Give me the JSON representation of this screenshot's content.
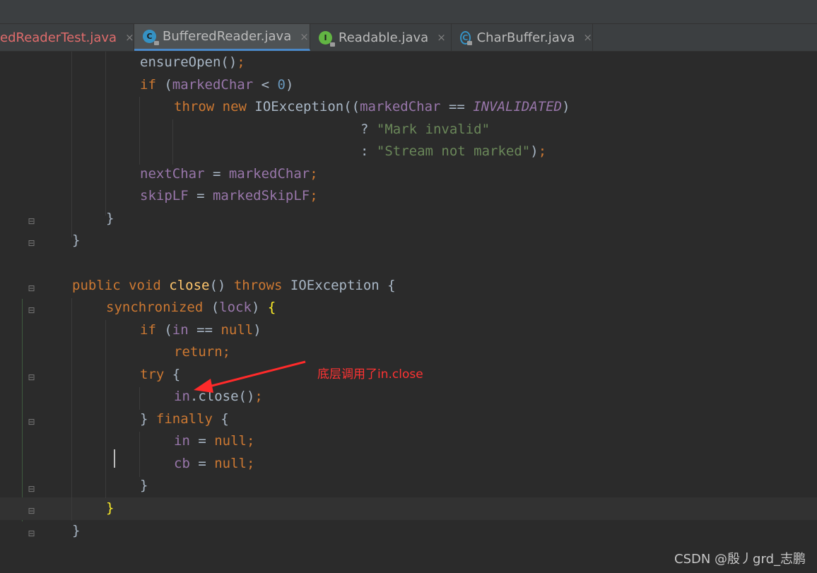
{
  "tabs": [
    {
      "label": "edReaderTest.java",
      "icon": "java-class-icon",
      "active": false,
      "modified": true
    },
    {
      "label": "BufferedReader.java",
      "icon": "class-icon",
      "icon_letter": "C",
      "active": true
    },
    {
      "label": "Readable.java",
      "icon": "interface-icon",
      "icon_letter": "I",
      "active": false
    },
    {
      "label": "CharBuffer.java",
      "icon": "abstract-class-icon",
      "icon_letter": "C",
      "active": false
    }
  ],
  "tab_close_glyph": "×",
  "code_lines": [
    [
      {
        "t": "ensureOpen",
        "c": "pl"
      },
      {
        "t": "()",
        "c": "pl"
      },
      {
        "t": ";",
        "c": "kw"
      }
    ],
    [
      {
        "t": "if",
        "c": "kw"
      },
      {
        "t": " (",
        "c": "pl"
      },
      {
        "t": "markedChar",
        "c": "fd"
      },
      {
        "t": " < ",
        "c": "pl"
      },
      {
        "t": "0",
        "c": "nm"
      },
      {
        "t": ")",
        "c": "pl"
      }
    ],
    [
      {
        "t": "throw new ",
        "c": "kw"
      },
      {
        "t": "IOException((",
        "c": "pl"
      },
      {
        "t": "markedChar",
        "c": "fd"
      },
      {
        "t": " == ",
        "c": "pl"
      },
      {
        "t": "INVALIDATED",
        "c": "fdi"
      },
      {
        "t": ")",
        "c": "pl"
      }
    ],
    [
      {
        "t": "? ",
        "c": "pl"
      },
      {
        "t": "\"Mark invalid\"",
        "c": "st"
      }
    ],
    [
      {
        "t": ": ",
        "c": "pl"
      },
      {
        "t": "\"Stream not marked\"",
        "c": "st"
      },
      {
        "t": ")",
        "c": "pl"
      },
      {
        "t": ";",
        "c": "kw"
      }
    ],
    [
      {
        "t": "nextChar",
        "c": "fd"
      },
      {
        "t": " = ",
        "c": "pl"
      },
      {
        "t": "markedChar",
        "c": "fd"
      },
      {
        "t": ";",
        "c": "kw"
      }
    ],
    [
      {
        "t": "skipLF",
        "c": "fd"
      },
      {
        "t": " = ",
        "c": "pl"
      },
      {
        "t": "markedSkipLF",
        "c": "fd"
      },
      {
        "t": ";",
        "c": "kw"
      }
    ],
    [
      {
        "t": "}",
        "c": "pl"
      }
    ],
    [
      {
        "t": "}",
        "c": "pl"
      }
    ],
    [],
    [
      {
        "t": "public void ",
        "c": "kw"
      },
      {
        "t": "close",
        "c": "fn"
      },
      {
        "t": "() ",
        "c": "pl"
      },
      {
        "t": "throws ",
        "c": "kw"
      },
      {
        "t": "IOException {",
        "c": "pl"
      }
    ],
    [
      {
        "t": "synchronized ",
        "c": "kw"
      },
      {
        "t": "(",
        "c": "pl"
      },
      {
        "t": "lock",
        "c": "fd"
      },
      {
        "t": ") ",
        "c": "pl"
      },
      {
        "t": "{",
        "c": "br"
      }
    ],
    [
      {
        "t": "if",
        "c": "kw"
      },
      {
        "t": " (",
        "c": "pl"
      },
      {
        "t": "in",
        "c": "fd"
      },
      {
        "t": " == ",
        "c": "pl"
      },
      {
        "t": "null",
        "c": "kw"
      },
      {
        "t": ")",
        "c": "pl"
      }
    ],
    [
      {
        "t": "return",
        "c": "kw"
      },
      {
        "t": ";",
        "c": "kw"
      }
    ],
    [
      {
        "t": "try ",
        "c": "kw"
      },
      {
        "t": "{",
        "c": "pl"
      }
    ],
    [
      {
        "t": "in",
        "c": "fd"
      },
      {
        "t": ".close()",
        "c": "pl"
      },
      {
        "t": ";",
        "c": "kw"
      }
    ],
    [
      {
        "t": "} ",
        "c": "pl"
      },
      {
        "t": "finally ",
        "c": "kw"
      },
      {
        "t": "{",
        "c": "pl"
      }
    ],
    [
      {
        "t": "in",
        "c": "fd"
      },
      {
        "t": " = ",
        "c": "pl"
      },
      {
        "t": "null",
        "c": "kw"
      },
      {
        "t": ";",
        "c": "kw"
      }
    ],
    [
      {
        "t": "cb",
        "c": "fd"
      },
      {
        "t": " = ",
        "c": "pl"
      },
      {
        "t": "null",
        "c": "kw"
      },
      {
        "t": ";",
        "c": "kw"
      }
    ],
    [
      {
        "t": "}",
        "c": "pl"
      }
    ],
    [
      {
        "t": "}",
        "c": "br"
      }
    ],
    [
      {
        "t": "}",
        "c": "pl"
      }
    ]
  ],
  "annotation": "底层调用了in.close",
  "watermark": "CSDN @殷丿grd_志鹏",
  "colors": {
    "background": "#2b2b2b",
    "keyword": "#cc7832",
    "field": "#9876aa",
    "string": "#6a8759",
    "number": "#6897bb",
    "method_decl": "#ffc66d",
    "annotation_red": "#ff3333",
    "active_tab_underline": "#4a88c7"
  }
}
